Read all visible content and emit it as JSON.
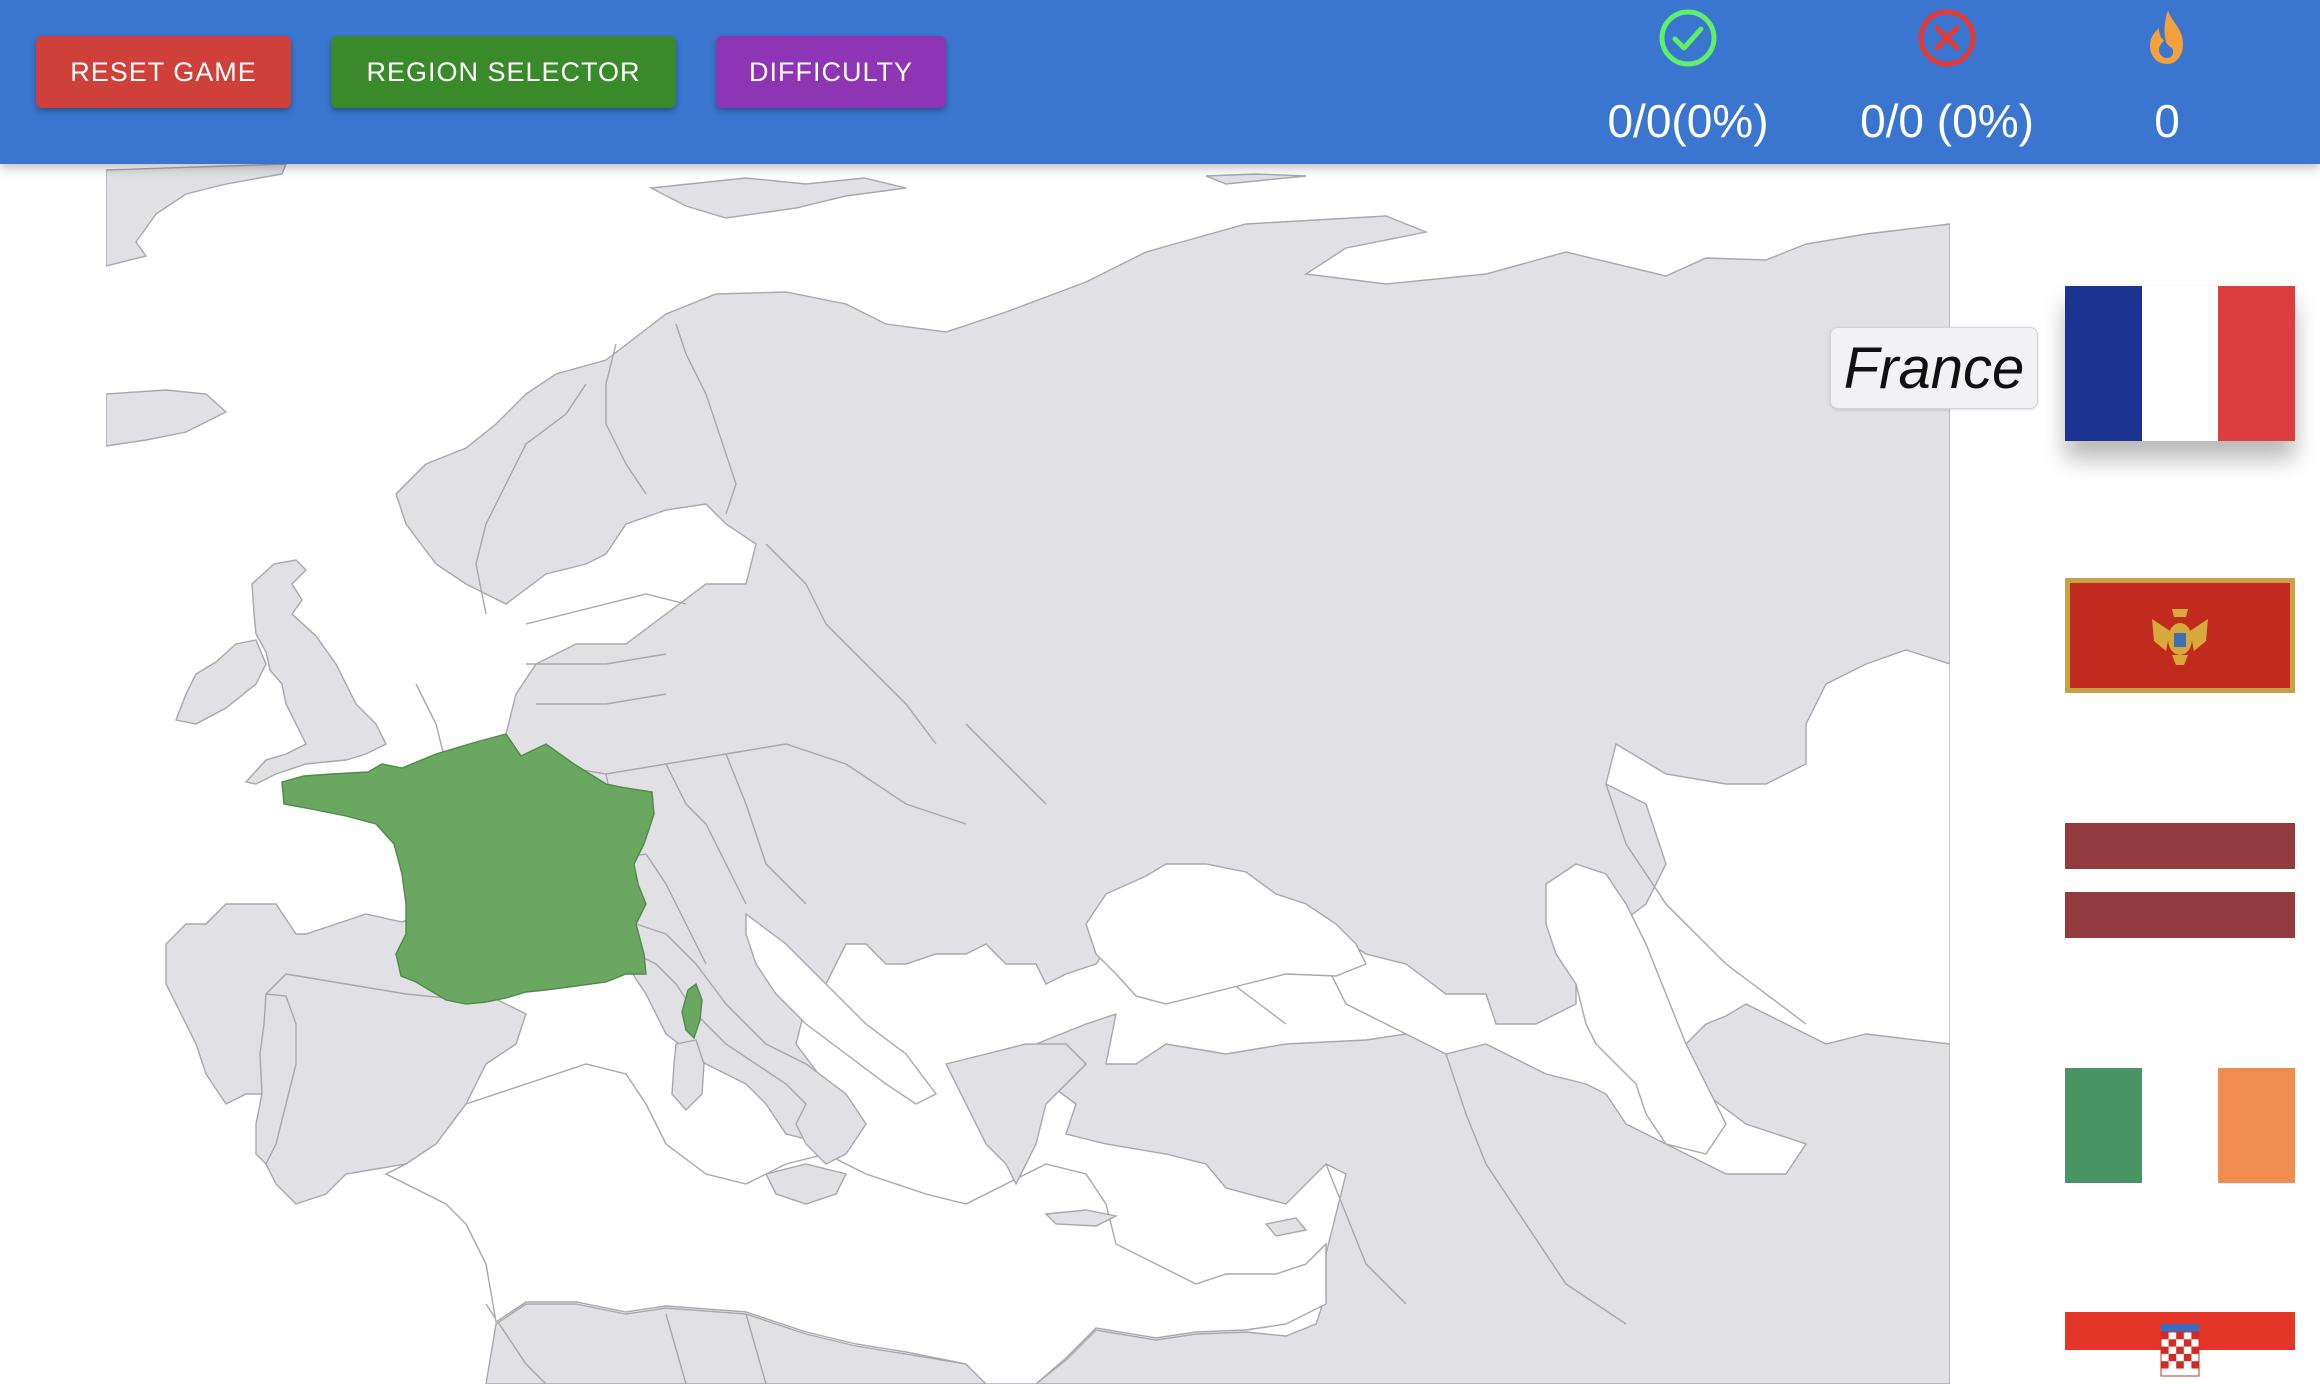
{
  "toolbar": {
    "reset_label": "RESET GAME",
    "region_label": "REGION SELECTOR",
    "difficulty_label": "DIFFICULTY",
    "colors": {
      "reset": "#d0403a",
      "region": "#3a8a2b",
      "difficulty": "#8e35b5",
      "bar": "#3a76cf"
    }
  },
  "stats": {
    "correct": {
      "icon": "check-circle-icon",
      "value": "0/0(0%)",
      "color": "#5ff06a"
    },
    "wrong": {
      "icon": "x-circle-icon",
      "value": "0/0 (0%)",
      "color": "#e53935"
    },
    "streak": {
      "icon": "flame-icon",
      "value": "0",
      "color": "#f5a13b"
    }
  },
  "map": {
    "highlighted_country": "France",
    "highlight_color": "#6aa862",
    "land_color": "#e1e1e5"
  },
  "question": {
    "label": "France"
  },
  "flags": [
    {
      "country": "France",
      "selected": true
    },
    {
      "country": "Montenegro",
      "selected": false
    },
    {
      "country": "Latvia",
      "selected": false
    },
    {
      "country": "Ireland",
      "selected": false
    },
    {
      "country": "Croatia",
      "selected": false
    }
  ]
}
